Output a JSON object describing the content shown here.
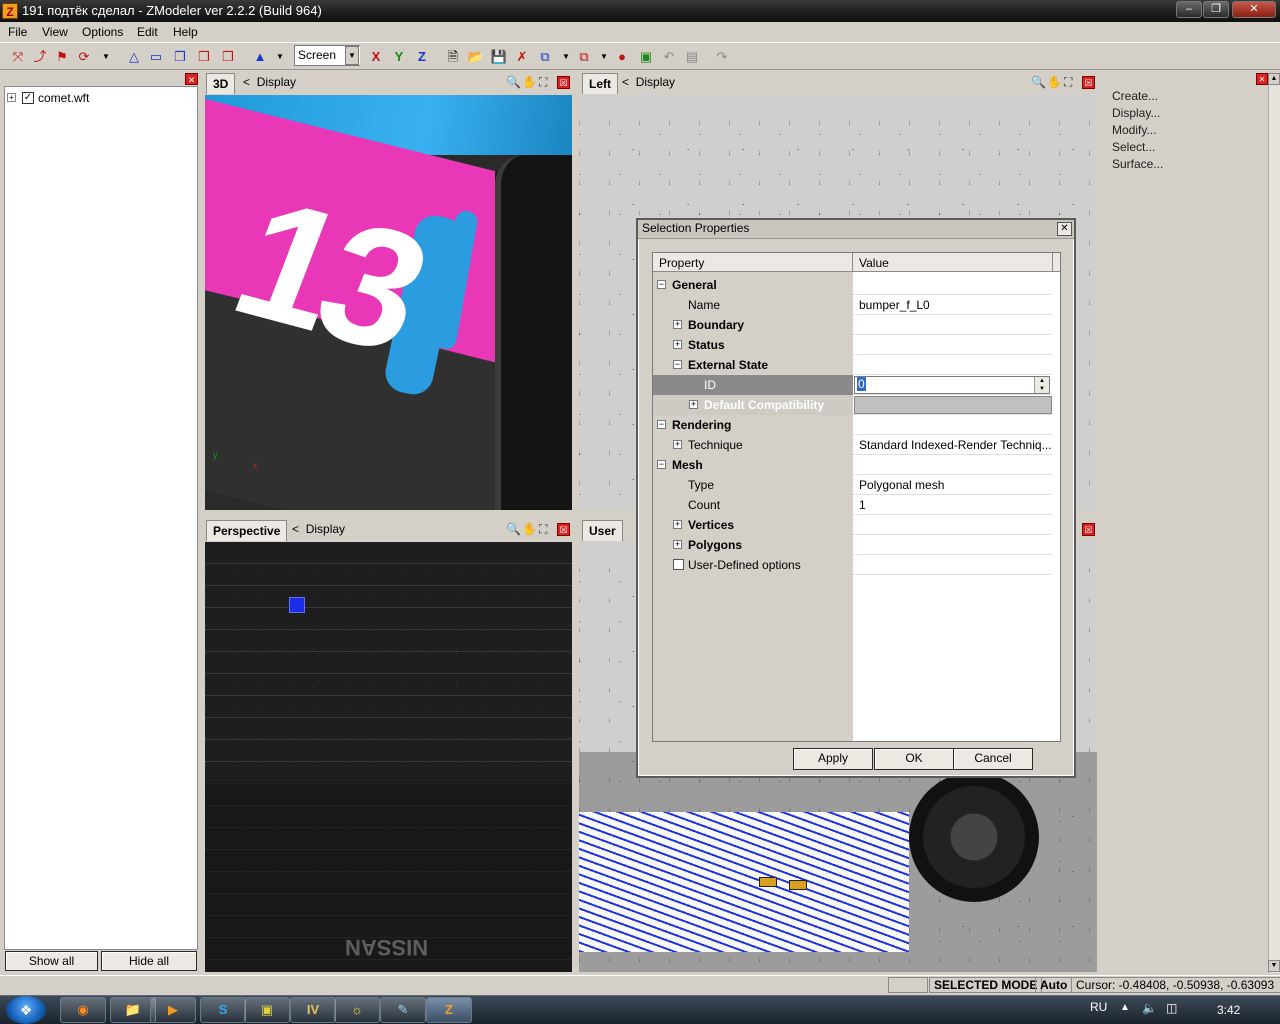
{
  "window": {
    "title": "191 подтёк сделал - ZModeler ver 2.2.2 (Build 964)",
    "app_icon": "Z"
  },
  "menu": [
    "File",
    "View",
    "Options",
    "Edit",
    "Help"
  ],
  "toolbar": {
    "view_select": "Screen",
    "axes": [
      "X",
      "Y",
      "Z"
    ]
  },
  "tree": {
    "items": [
      {
        "label": "comet.wft",
        "checked": true
      }
    ],
    "show_all": "Show all",
    "hide_all": "Hide all"
  },
  "viewports": [
    {
      "tab": "3D",
      "display": "Display"
    },
    {
      "tab": "Left",
      "display": "Display"
    },
    {
      "tab": "Perspective",
      "display": "Display"
    },
    {
      "tab": "User",
      "display": ""
    }
  ],
  "scene_texts": {
    "number": "13",
    "nissan": "NISSAN"
  },
  "command_panel": [
    "Create...",
    "Display...",
    "Modify...",
    "Select...",
    "Surface..."
  ],
  "dialog": {
    "title": "Selection Properties",
    "columns": [
      "Property",
      "Value"
    ],
    "rows": [
      {
        "name": "General",
        "value": "",
        "level": 0,
        "expander": "−",
        "bold": true
      },
      {
        "name": "Name",
        "value": "bumper_f_L0",
        "level": 1,
        "expander": "",
        "bold": false
      },
      {
        "name": "Boundary",
        "value": "",
        "level": 1,
        "expander": "+",
        "bold": true
      },
      {
        "name": "Status",
        "value": "",
        "level": 1,
        "expander": "+",
        "bold": true
      },
      {
        "name": "External State",
        "value": "",
        "level": 1,
        "expander": "−",
        "bold": true
      },
      {
        "name": "ID",
        "value": "0",
        "level": 2,
        "expander": "",
        "bold": false
      },
      {
        "name": "Default Compatibility",
        "value": "",
        "level": 2,
        "expander": "+",
        "bold": true
      },
      {
        "name": "Rendering",
        "value": "",
        "level": 0,
        "expander": "−",
        "bold": true
      },
      {
        "name": "Technique",
        "value": "Standard Indexed-Render Techniq...",
        "level": 1,
        "expander": "+",
        "bold": false
      },
      {
        "name": "Mesh",
        "value": "",
        "level": 0,
        "expander": "−",
        "bold": true
      },
      {
        "name": "Type",
        "value": "Polygonal mesh",
        "level": 1,
        "expander": "",
        "bold": false
      },
      {
        "name": "Count",
        "value": "1",
        "level": 1,
        "expander": "",
        "bold": false
      },
      {
        "name": "Vertices",
        "value": "",
        "level": 1,
        "expander": "+",
        "bold": true
      },
      {
        "name": "Polygons",
        "value": "",
        "level": 1,
        "expander": "+",
        "bold": true
      },
      {
        "name": "User-Defined options",
        "value": "",
        "level": 1,
        "expander": "checkbox",
        "bold": false
      }
    ],
    "buttons": {
      "apply": "Apply",
      "ok": "OK",
      "cancel": "Cancel"
    }
  },
  "status": {
    "mode": "SELECTED MODE",
    "auto": "Auto",
    "cursor": "Cursor: -0.48408, -0.50938, -0.63093"
  },
  "taskbar": {
    "lang": "RU",
    "time": "3:42"
  },
  "colors": {
    "selection_blue": "#1a2ee8",
    "livery_pink": "#e838b8",
    "livery_blue": "#2aa4e6",
    "close_red": "#dd2222"
  }
}
